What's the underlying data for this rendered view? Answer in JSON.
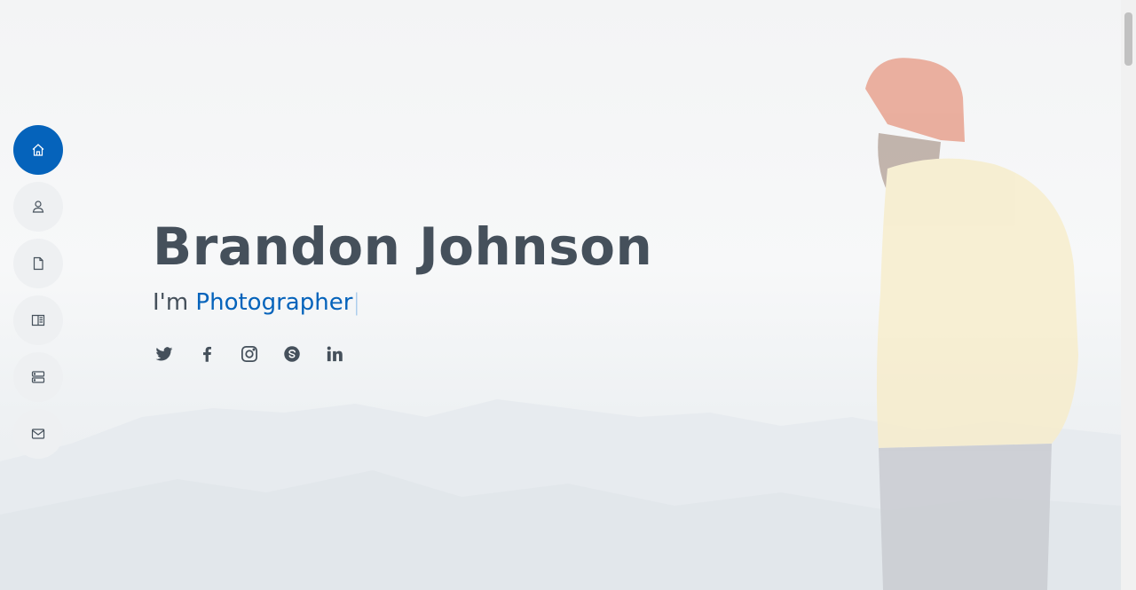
{
  "nav": {
    "items": [
      {
        "id": "home",
        "icon": "home-icon",
        "active": true
      },
      {
        "id": "about",
        "icon": "person-icon",
        "active": false
      },
      {
        "id": "resume",
        "icon": "file-icon",
        "active": false
      },
      {
        "id": "portfolio",
        "icon": "book-icon",
        "active": false
      },
      {
        "id": "services",
        "icon": "server-icon",
        "active": false
      },
      {
        "id": "contact",
        "icon": "envelope-icon",
        "active": false
      }
    ]
  },
  "hero": {
    "name": "Brandon Johnson",
    "prefix": "I'm ",
    "typed": "Photographer",
    "cursor": "|"
  },
  "socials": [
    "twitter-icon",
    "facebook-icon",
    "instagram-icon",
    "skype-icon",
    "linkedin-icon"
  ],
  "colors": {
    "accent": "#0563bb",
    "text": "#45505b",
    "nav_bg": "#eef0f2"
  }
}
